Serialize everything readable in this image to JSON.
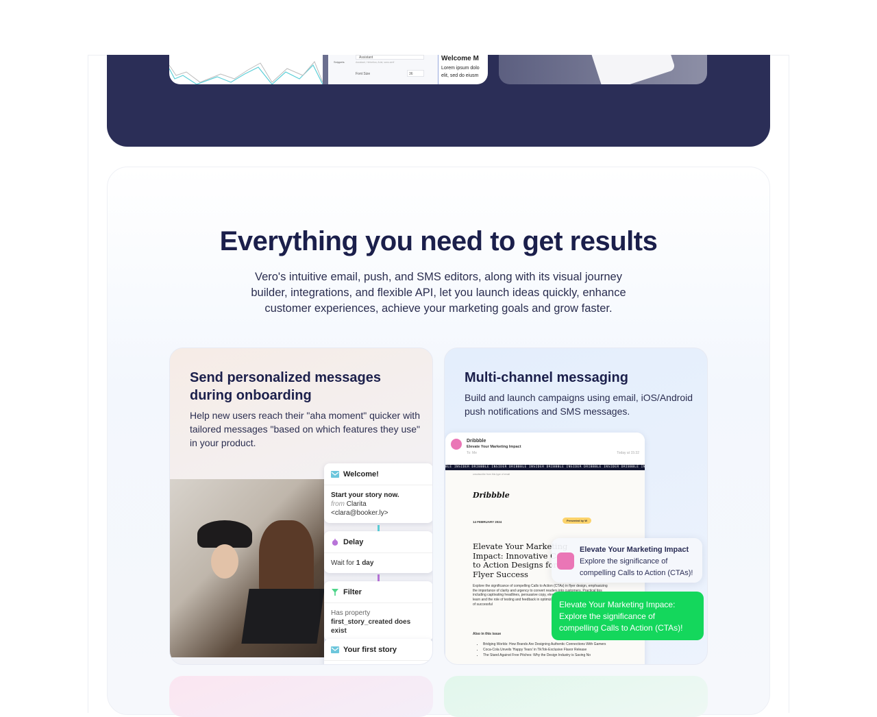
{
  "hero_preview": {
    "snippets_label": "Snippets",
    "font_field": "Assistant",
    "font_hint": "Assistant, Helvetica, Arial, sans-serif",
    "font_size_label": "Font Size",
    "font_size_value": "36",
    "doc_title": "Welcome M",
    "doc_text": "Lorem ipsum dolo elit, sed do eiusm"
  },
  "section": {
    "title": "Everything you need to get results",
    "description": "Vero's intuitive email, push, and SMS editors, along with its visual journey builder, integrations, and flexible API, let you launch ideas quickly, enhance customer experiences, achieve your marketing goals and grow faster."
  },
  "cards": [
    {
      "title": "Send personalized messages during onboarding",
      "description": "Help new users reach their \"aha moment\" quicker with tailored messages \"based on which features they use\" in your product.",
      "flow": [
        {
          "icon": "mail-icon",
          "title": "Welcome!",
          "line1": "Start your story now.",
          "from_label": "from",
          "from_name": "Clarita",
          "from_email": "<clara@booker.ly>"
        },
        {
          "icon": "timer-icon",
          "title": "Delay",
          "text": "Wait for",
          "bold": "1 day"
        },
        {
          "icon": "filter-icon",
          "title": "Filter",
          "line1": "Has property",
          "line2": "first_story_created does exist"
        },
        {
          "icon": "mail-icon",
          "title": "Your first story"
        }
      ]
    },
    {
      "title": "Multi-channel messaging",
      "description": "Build and launch campaigns using email, iOS/Android push notifications and SMS messages.",
      "email": {
        "sender": "Dribbble",
        "subject": "Elevate Your Marketing Impact",
        "to": "To: Me",
        "time": "Today at 15:32",
        "band": "BLE INSIDER   DRIBBBLE INSIDER   DRIBBBLE INSIDER   DRIBBBLE INSIDER   DRIBBBLE INSIDER   DRIBBBLE INSIDER   DRIBBBLE INSIDER",
        "unsubscribe": "unsubscribe from this type of email",
        "logo": "Dribbble",
        "date": "14 FEBRUARY 2024",
        "presented": "Presented by W",
        "headline": "Elevate Your Marketing Impact: Innovative Call to Action Designs for Flyer Success",
        "body": "Explore the significance of compelling Calls to Action (CTAs) in flyer design, emphasizing the importance of clarity and urgency to convert readers into customers. Practical tips including captivating headlines, persuasive copy, elements, are in store. On the flip side, learn and the role of testing and feedback in optimizing, showcasing real-world examples of successful",
        "also": "Also in this issue",
        "items": [
          "Bridging Worlds: How Brands Are Designing Authentic Connections With Gamers",
          "Coca-Cola Unveils 'Happy Tears' in TikTok-Exclusive Flavor Release",
          "The Stand Against Free Pitches: Why the Design Industry is Saving No"
        ]
      },
      "push": {
        "title": "Elevate Your Marketing Impact",
        "text": "Explore the significance of compelling Calls to Action (CTAs)!"
      },
      "sms": "Elevate Your Marketing Impace: Explore the significance of compelling Calls to Action (CTAs)!"
    }
  ],
  "colors": {
    "navy": "#2b2e57",
    "heading": "#1b1f4b",
    "sms_green": "#14d75c",
    "pink": "#ea76b6"
  }
}
